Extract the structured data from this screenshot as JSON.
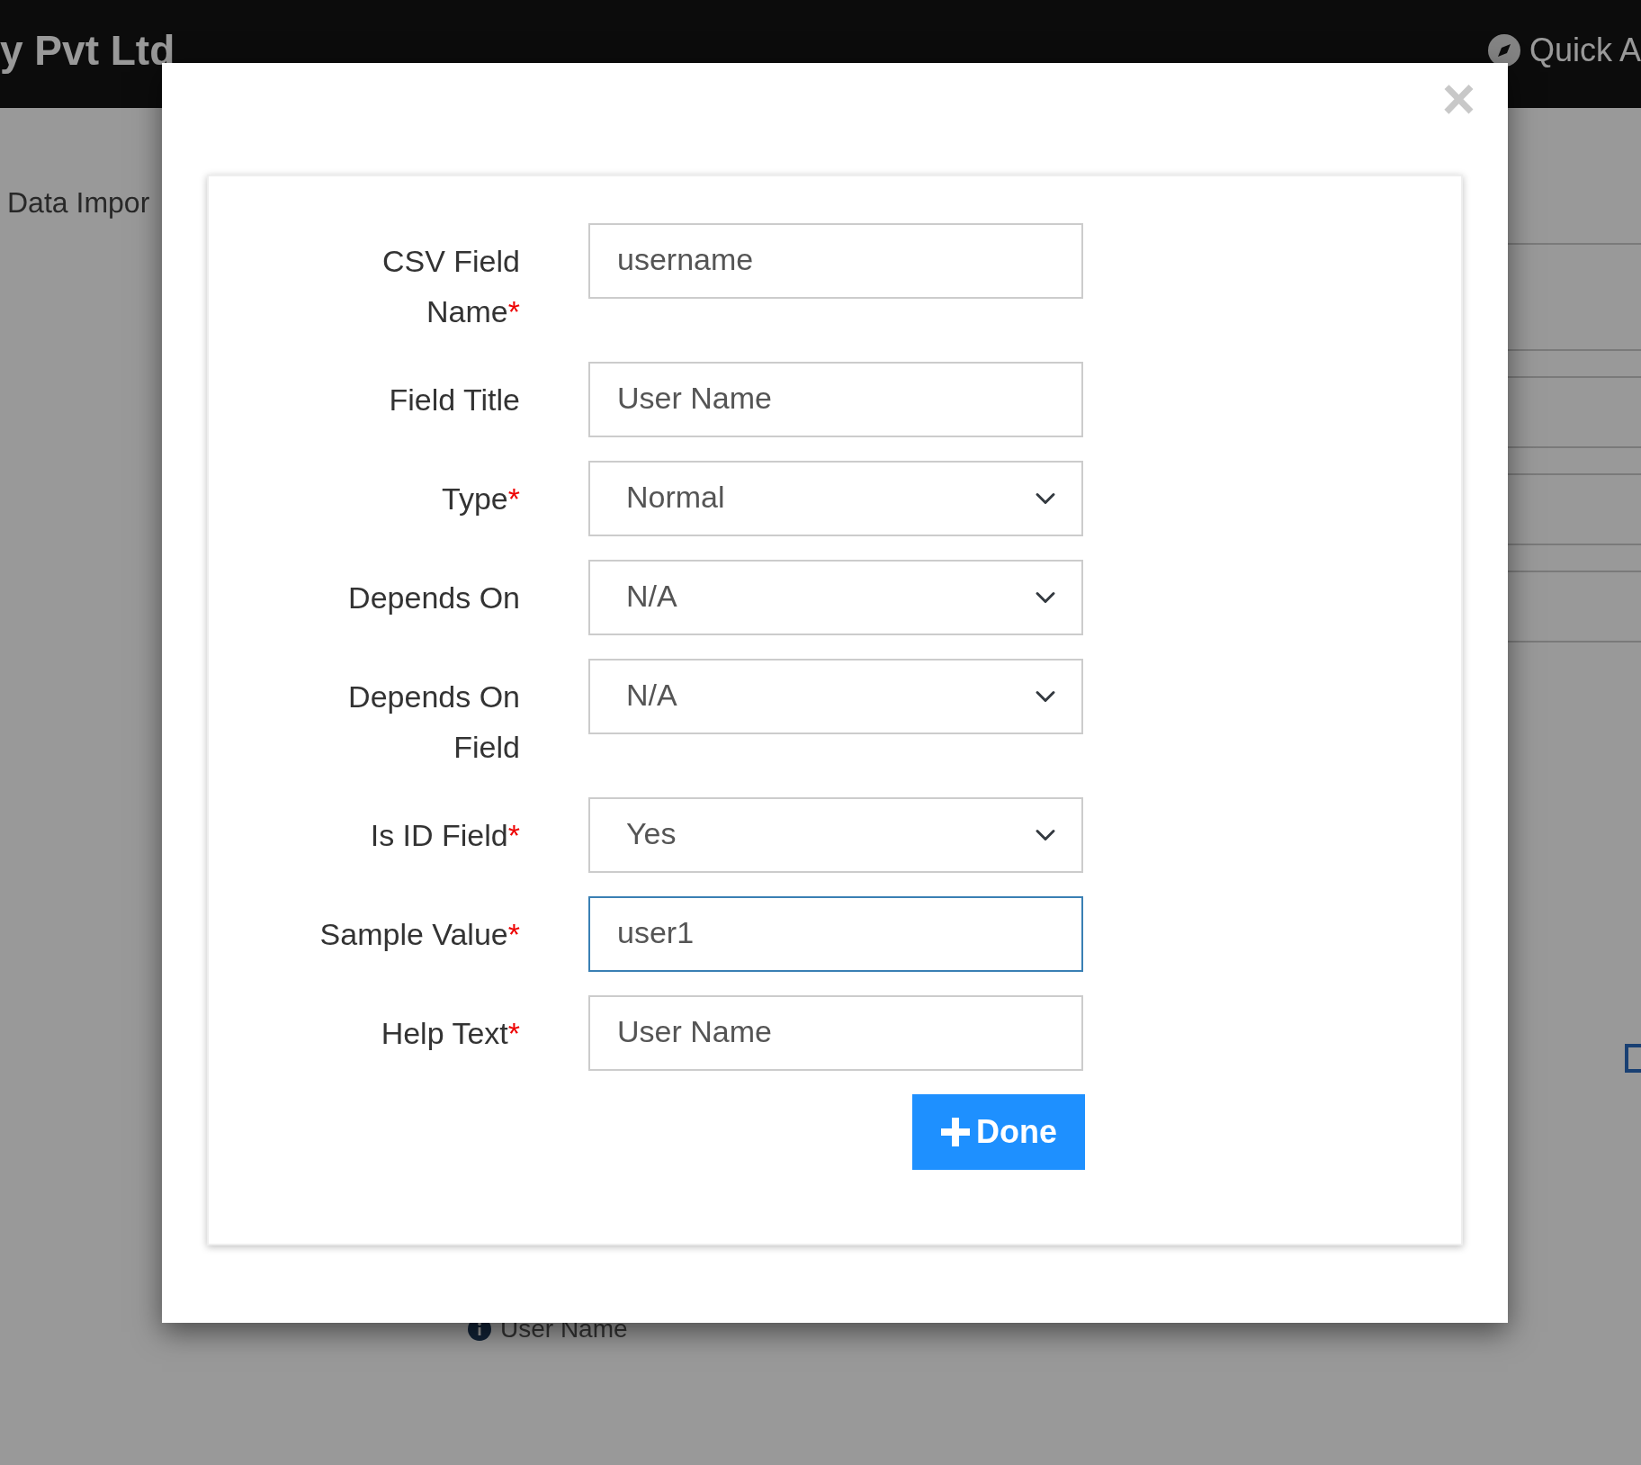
{
  "header": {
    "brand": "y Pvt Ltd",
    "quick_access": "Quick A"
  },
  "breadcrumb": "Data Impor",
  "background_hint": "User Name",
  "modal": {
    "close": "×",
    "fields": [
      {
        "kind": "text",
        "label": "CSV Field Name",
        "required": true,
        "value": "username",
        "focused": false
      },
      {
        "kind": "text",
        "label": "Field Title",
        "required": false,
        "value": "User Name",
        "focused": false
      },
      {
        "kind": "select",
        "label": "Type",
        "required": true,
        "value": "Normal",
        "focused": false
      },
      {
        "kind": "select",
        "label": "Depends On",
        "required": false,
        "value": "N/A",
        "focused": false
      },
      {
        "kind": "select",
        "label": "Depends On Field",
        "required": false,
        "value": "N/A",
        "focused": false
      },
      {
        "kind": "select",
        "label": "Is ID Field",
        "required": true,
        "value": "Yes",
        "focused": false
      },
      {
        "kind": "text",
        "label": "Sample Value",
        "required": true,
        "value": "user1",
        "focused": true
      },
      {
        "kind": "text",
        "label": "Help Text",
        "required": true,
        "value": "User Name",
        "focused": false
      }
    ],
    "required_mark": "*",
    "submit": "Done"
  }
}
